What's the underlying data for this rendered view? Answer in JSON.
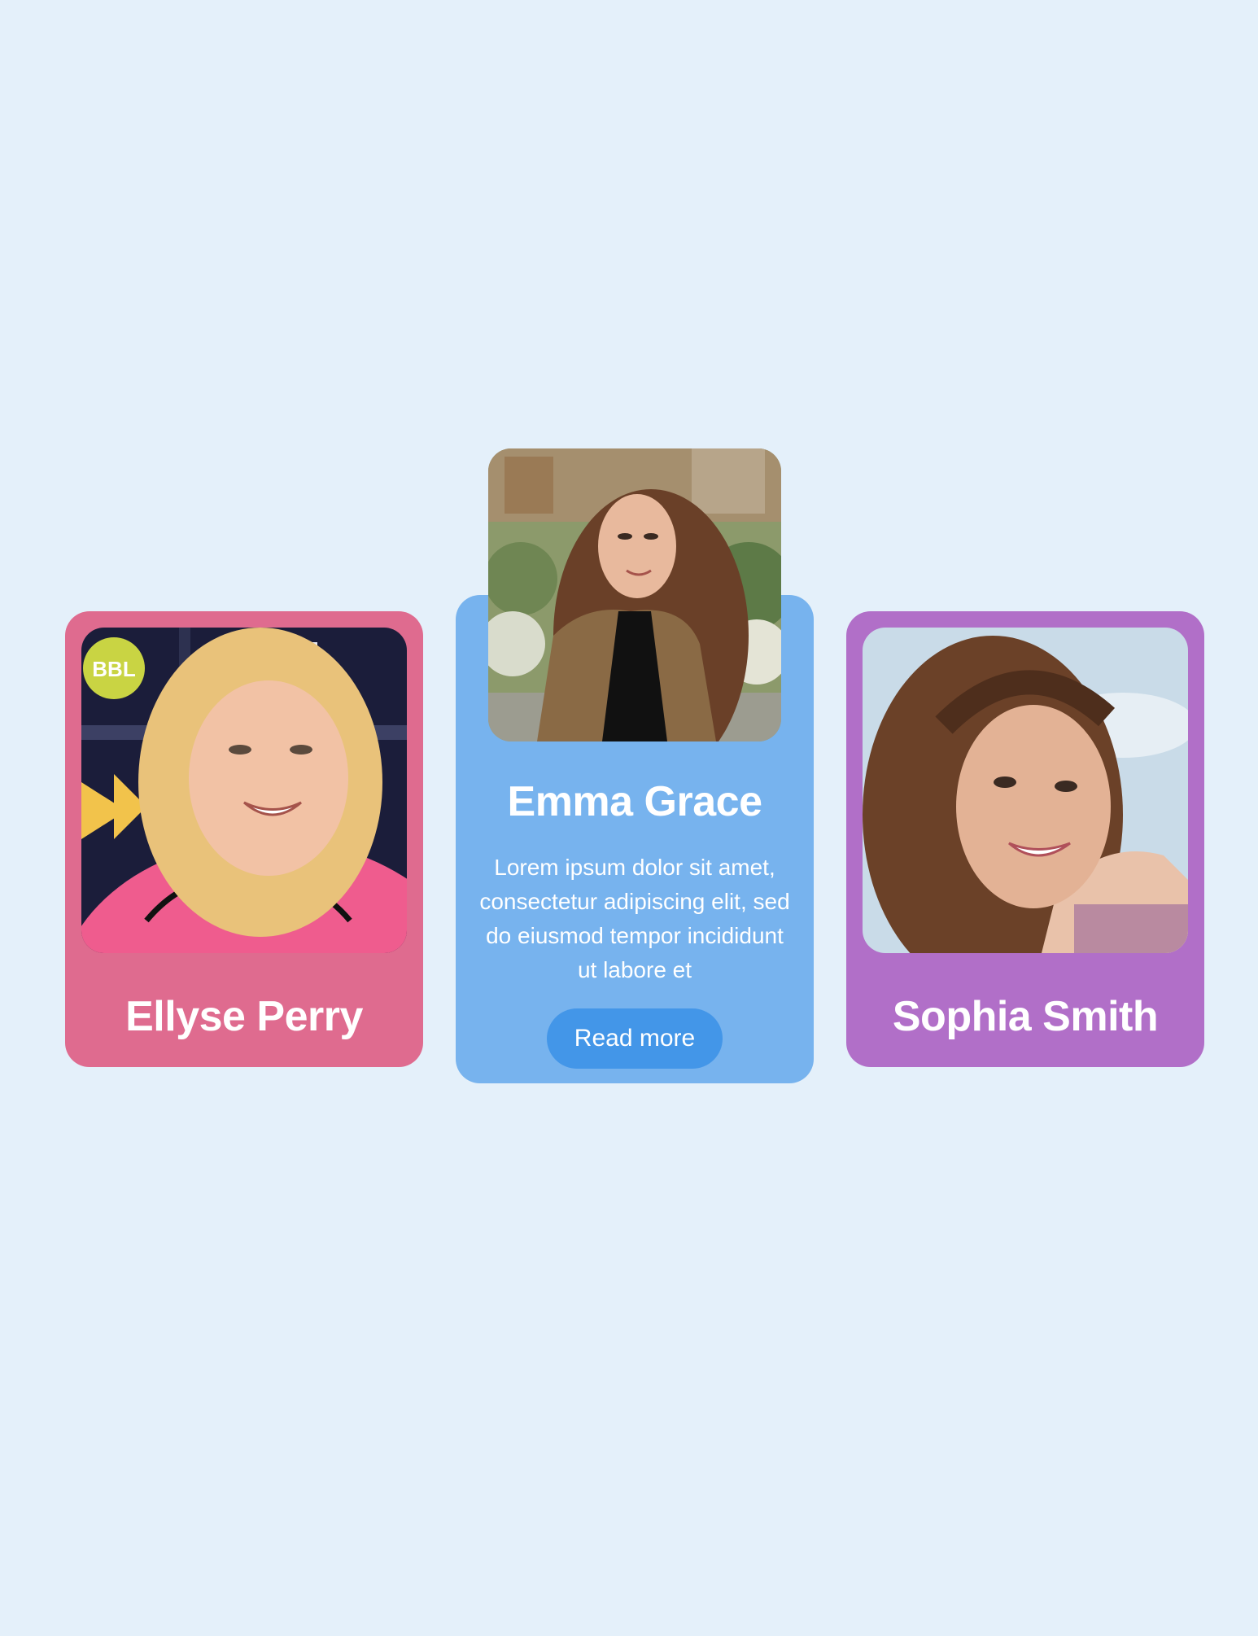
{
  "cards": [
    {
      "name": "Ellyse Perry",
      "color": "#df6b8f",
      "photo": "portrait-photo-blonde-woman-pink-jersey"
    },
    {
      "name": "Emma Grace",
      "color": "#77b3ee",
      "photo": "portrait-photo-woman-brown-jacket",
      "description": "Lorem ipsum dolor sit amet, consectetur adipiscing elit, sed do eiusmod tempor incididunt ut labore et",
      "button_label": "Read more",
      "button_color": "#4396e8"
    },
    {
      "name": "Sophia Smith",
      "color": "#b16fc8",
      "photo": "portrait-photo-brunette-woman-smiling"
    }
  ],
  "background_color": "#e4f0fa"
}
